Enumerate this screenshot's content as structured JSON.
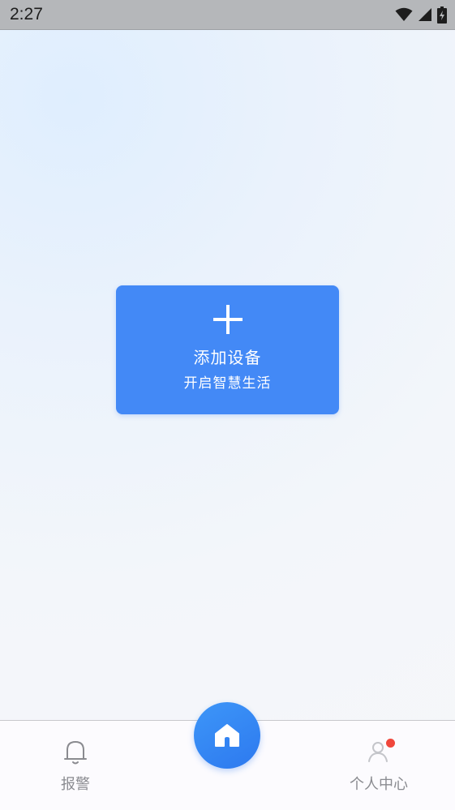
{
  "status_bar": {
    "time": "2:27",
    "icons": [
      "wifi-icon",
      "cell-signal-icon",
      "battery-charging-icon"
    ]
  },
  "add_device": {
    "icon": "plus-icon",
    "title": "添加设备",
    "subtitle": "开启智慧生活"
  },
  "bottom_nav": {
    "items": [
      {
        "label": "报警",
        "icon": "bell-icon"
      },
      {
        "label": "",
        "icon": "home-icon"
      },
      {
        "label": "个人中心",
        "icon": "user-icon",
        "badge": true
      }
    ]
  },
  "colors": {
    "accent": "#4389f6",
    "fab": "#2d79ef",
    "badge": "#f0473c",
    "nav_text": "#8a8b90"
  }
}
